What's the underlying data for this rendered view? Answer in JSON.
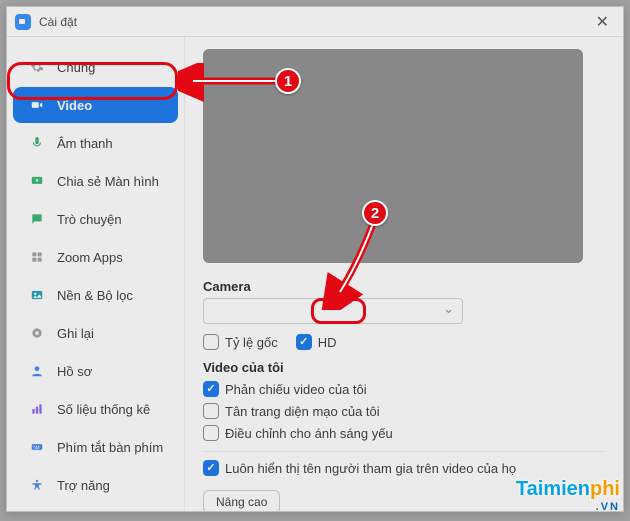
{
  "window": {
    "title": "Cài đặt"
  },
  "sidebar": {
    "items": [
      {
        "label": "Chung",
        "icon": "gear",
        "color": "#9aa0a6"
      },
      {
        "label": "Video",
        "icon": "video",
        "color": "#0e73ed",
        "active": true
      },
      {
        "label": "Âm thanh",
        "icon": "audio",
        "color": "#2fb36b"
      },
      {
        "label": "Chia sẻ Màn hình",
        "icon": "share",
        "color": "#2fb36b"
      },
      {
        "label": "Trò chuyện",
        "icon": "chat",
        "color": "#2fb36b"
      },
      {
        "label": "Zoom Apps",
        "icon": "apps",
        "color": "#9aa0a6"
      },
      {
        "label": "Nền & Bộ lọc",
        "icon": "bg",
        "color": "#17a2b8"
      },
      {
        "label": "Ghi lại",
        "icon": "record",
        "color": "#9aa0a6"
      },
      {
        "label": "Hồ sơ",
        "icon": "profile",
        "color": "#3b82f6"
      },
      {
        "label": "Số liệu thống kê",
        "icon": "stats",
        "color": "#8b5cf6"
      },
      {
        "label": "Phím tắt bàn phím",
        "icon": "keyboard",
        "color": "#3b82f6"
      },
      {
        "label": "Trợ năng",
        "icon": "access",
        "color": "#3b82f6"
      }
    ]
  },
  "content": {
    "camera_label": "Camera",
    "aspect_ratio_label": "Tỷ lệ gốc",
    "hd_label": "HD",
    "my_video_label": "Video của tôi",
    "options": [
      {
        "label": "Phản chiếu video của tôi",
        "checked": true
      },
      {
        "label": "Tân trang diện mạo của tôi",
        "checked": false
      },
      {
        "label": "Điều chỉnh cho ánh sáng yếu",
        "checked": false
      }
    ],
    "always_show_label": "Luôn hiển thị tên người tham gia trên video của họ",
    "always_show_checked": true,
    "advanced_label": "Nâng cao"
  },
  "annotations": {
    "step1": "1",
    "step2": "2"
  },
  "watermark": {
    "part1": "Taimien",
    "part2": "phi",
    "suffix": ".VN"
  }
}
